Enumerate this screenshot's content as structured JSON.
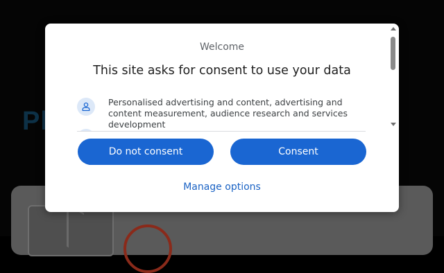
{
  "background": {
    "heading_partial": "Pl"
  },
  "dialog": {
    "welcome": "Welcome",
    "title": "This site asks for consent to use your data",
    "purposes": [
      {
        "icon": "person-icon",
        "text": "Personalised advertising and content, advertising and content measurement, audience research and services development"
      }
    ],
    "buttons": {
      "do_not_consent": "Do not consent",
      "consent": "Consent"
    },
    "manage_options": "Manage options"
  },
  "colors": {
    "accent": "#1a66d2",
    "link": "#1a62c4",
    "icon_bg": "#dce8f8"
  }
}
